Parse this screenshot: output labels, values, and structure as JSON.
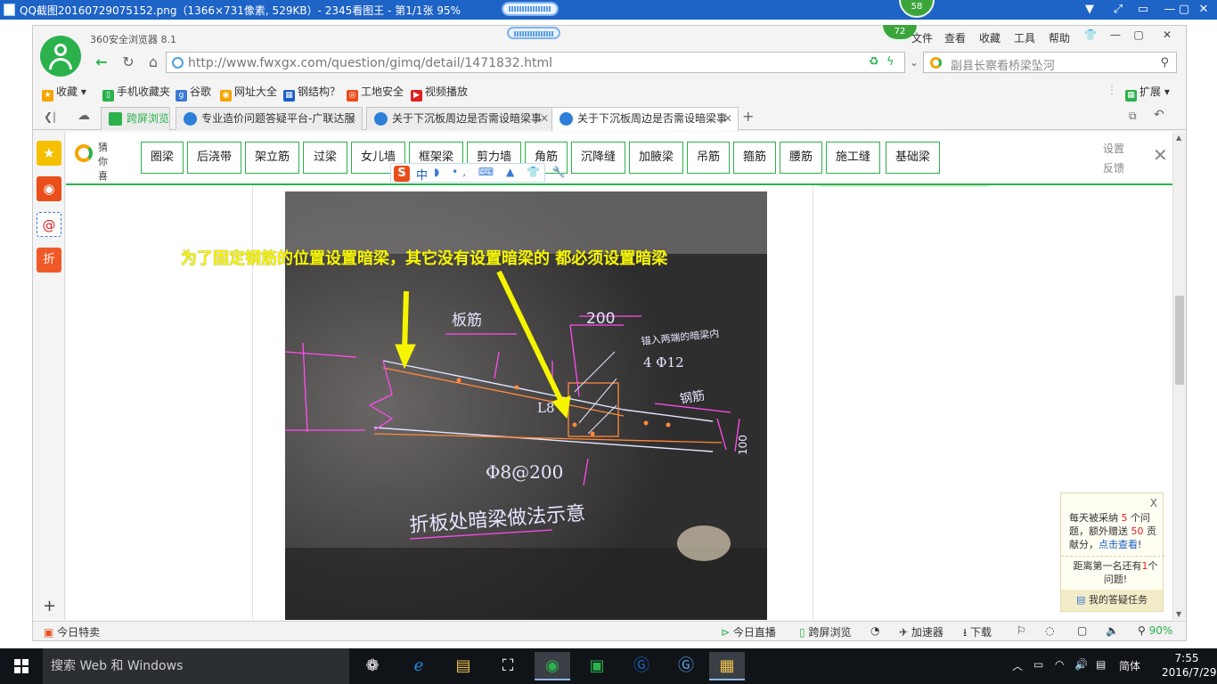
{
  "viewer": {
    "title": "QQ截图20160729075152.png（1366×731像素, 529KB）- 2345看图王 - 第1/1张 95%",
    "controls": [
      "▼",
      "⤢",
      "▭",
      "—",
      "▢",
      "✕"
    ]
  },
  "browser": {
    "brand": "360安全浏览器 8.1",
    "badge_outer": "58",
    "badge_inner": "72",
    "menu": [
      "文件",
      "查看",
      "收藏",
      "工具",
      "帮助"
    ],
    "window_controls": [
      "👕",
      "—",
      "▢",
      "✕"
    ],
    "url": "http://www.fwxgx.com/question/gimq/detail/1471832.html",
    "search_placeholder": "副县长察看桥梁坠河",
    "favorites": [
      {
        "label": "收藏",
        "icon": "star-icon",
        "color": "#f5a500"
      },
      {
        "label": "手机收藏夹",
        "icon": "phone-icon",
        "color": "#2bb24c"
      },
      {
        "label": "谷歌",
        "icon": "google-icon",
        "color": "#3b7ad6"
      },
      {
        "label": "网址大全",
        "icon": "globe-icon",
        "color": "#f5a500"
      },
      {
        "label": "钢结构？",
        "icon": "site-icon",
        "color": "#1a5fc8"
      },
      {
        "label": "工地安全",
        "icon": "safety-icon",
        "color": "#e94e1b"
      },
      {
        "label": "视频播放",
        "icon": "video-icon",
        "color": "#e02020"
      }
    ],
    "extensions_label": "扩展",
    "tabs": [
      {
        "label": "跨屏浏览",
        "active": false
      },
      {
        "label": "专业造价问题答疑平台-广联达服",
        "active": false
      },
      {
        "label": "关于下沉板周边是否需设暗梁事",
        "active": false
      },
      {
        "label": "关于下沉板周边是否需设暗梁事",
        "active": true
      }
    ]
  },
  "tagbar": {
    "guess_label": "猜你喜欢",
    "tags": [
      "圈梁",
      "后浇带",
      "架立筋",
      "过梁",
      "女儿墙",
      "框架梁",
      "剪力墙",
      "角筋",
      "沉降缝",
      "加腋梁",
      "吊筋",
      "箍筋",
      "腰筋",
      "施工缝",
      "基础梁"
    ],
    "settings": "设置",
    "feedback": "反馈"
  },
  "ime": {
    "logo": "S",
    "mode": "中",
    "tools": "◗ •, ⌨ ▲ 👕 🔧"
  },
  "content": {
    "annotation": "为了固定钢筋的位置设置暗梁，其它没有设置暗梁的 都必须设置暗梁",
    "drawing_labels": {
      "slab_rebar": "板筋",
      "dim200": "200",
      "anchor_note": "锚入两端的暗梁内",
      "rebar_4": "4 Φ12",
      "label_l": "L8",
      "steel": "钢筋",
      "spacing": "Φ8@200",
      "dim100": "100",
      "caption": "折板处暗梁做法示意"
    }
  },
  "task_widget": {
    "line1_a": "每天被采纳",
    "line1_n": "5",
    "line1_b": "个问题，额外赠送",
    "line1_n2": "50",
    "line1_c": "贡献分，",
    "line1_link": "点击查看",
    "line1_end": "!",
    "line2_a": "距离第一名还有",
    "line2_n": "1",
    "line2_b": "个问题!",
    "footer": "我的答疑任务"
  },
  "statusbar": {
    "left": "今日特卖",
    "items": [
      "今日直播",
      "跨屏浏览",
      "加速器",
      "下载"
    ],
    "zoom": "90%"
  },
  "taskbar": {
    "search": "搜索 Web 和 Windows",
    "lang": "简体",
    "time": "7:55",
    "date": "2016/7/29"
  }
}
